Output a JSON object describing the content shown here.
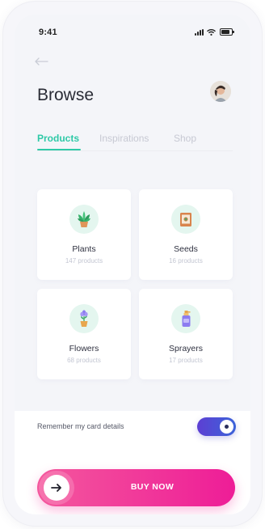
{
  "status_bar": {
    "time": "9:41"
  },
  "header": {
    "title": "Browse"
  },
  "tabs": [
    {
      "label": "Products",
      "active": true
    },
    {
      "label": "Inspirations",
      "active": false
    },
    {
      "label": "Shop",
      "active": false
    }
  ],
  "categories": [
    {
      "name": "Plants",
      "count": "147 products",
      "icon": "potted-plant-icon"
    },
    {
      "name": "Seeds",
      "count": "16 products",
      "icon": "seed-packet-icon"
    },
    {
      "name": "Flowers",
      "count": "68 products",
      "icon": "flower-pot-icon"
    },
    {
      "name": "Sprayers",
      "count": "17 products",
      "icon": "spray-bottle-icon"
    }
  ],
  "settings": {
    "remember_card_label": "Remember my card details",
    "remember_card_on": true
  },
  "cta": {
    "label": "BUY NOW"
  },
  "colors": {
    "accent": "#2ec9a7",
    "cta": "#ee1d97",
    "toggle": "#4b4fd6"
  }
}
